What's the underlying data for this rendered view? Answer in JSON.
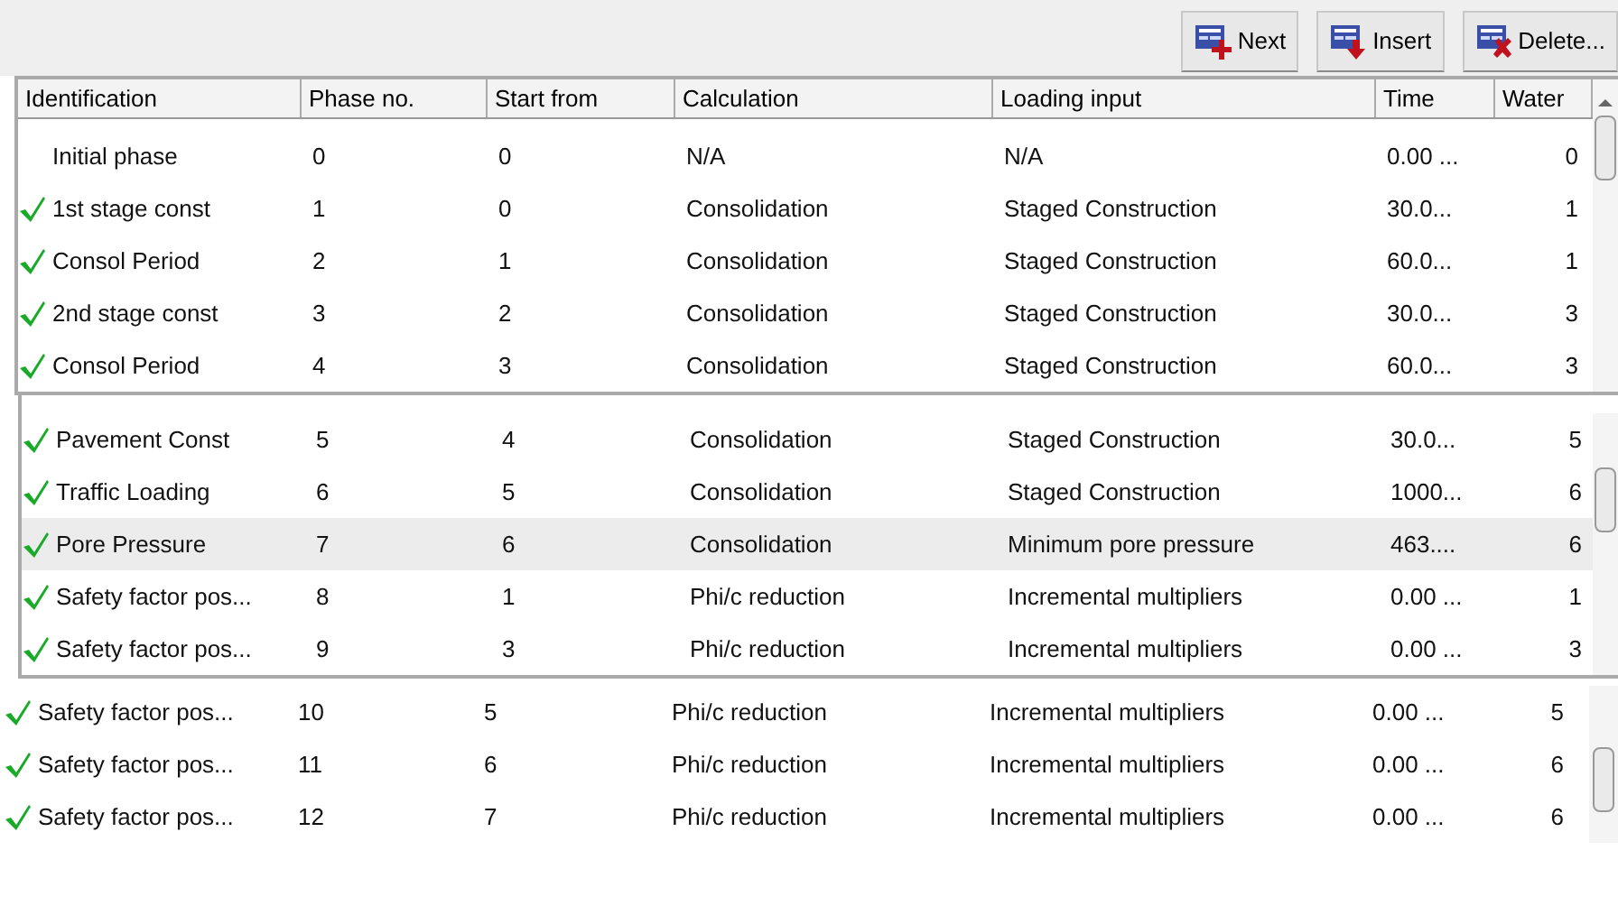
{
  "toolbar": {
    "buttons": [
      {
        "label": "Next",
        "kind": "add"
      },
      {
        "label": "Insert",
        "kind": "insert"
      },
      {
        "label": "Delete...",
        "kind": "delete"
      }
    ]
  },
  "table": {
    "columns": [
      "Identification",
      "Phase no.",
      "Start from",
      "Calculation",
      "Loading input",
      "Time",
      "Water"
    ],
    "panels": [
      {
        "rows": [
          {
            "cells": [
              "Initial phase",
              "0",
              "0",
              "N/A",
              "N/A",
              "0.00 ...",
              "0"
            ],
            "checked": false,
            "selected": false
          },
          {
            "cells": [
              "1st stage const",
              "1",
              "0",
              "Consolidation",
              "Staged Construction",
              "30.0...",
              "1"
            ],
            "checked": true,
            "selected": false
          },
          {
            "cells": [
              "Consol Period",
              "2",
              "1",
              "Consolidation",
              "Staged Construction",
              "60.0...",
              "1"
            ],
            "checked": true,
            "selected": false
          },
          {
            "cells": [
              "2nd stage const",
              "3",
              "2",
              "Consolidation",
              "Staged Construction",
              "30.0...",
              "3"
            ],
            "checked": true,
            "selected": false
          },
          {
            "cells": [
              "Consol Period",
              "4",
              "3",
              "Consolidation",
              "Staged Construction",
              "60.0...",
              "3"
            ],
            "checked": true,
            "selected": false
          }
        ]
      },
      {
        "rows": [
          {
            "cells": [
              "Pavement Const",
              "5",
              "4",
              "Consolidation",
              "Staged Construction",
              "30.0...",
              "5"
            ],
            "checked": true,
            "selected": false
          },
          {
            "cells": [
              "Traffic Loading",
              "6",
              "5",
              "Consolidation",
              "Staged Construction",
              "1000...",
              "6"
            ],
            "checked": true,
            "selected": false
          },
          {
            "cells": [
              "Pore Pressure",
              "7",
              "6",
              "Consolidation",
              "Minimum pore pressure",
              "463....",
              "6"
            ],
            "checked": true,
            "selected": true
          },
          {
            "cells": [
              "Safety factor pos...",
              "8",
              "1",
              "Phi/c reduction",
              "Incremental multipliers",
              "0.00 ...",
              "1"
            ],
            "checked": true,
            "selected": false
          },
          {
            "cells": [
              "Safety factor pos...",
              "9",
              "3",
              "Phi/c reduction",
              "Incremental multipliers",
              "0.00 ...",
              "3"
            ],
            "checked": true,
            "selected": false
          }
        ]
      },
      {
        "rows": [
          {
            "cells": [
              "Safety factor pos...",
              "10",
              "5",
              "Phi/c reduction",
              "Incremental multipliers",
              "0.00 ...",
              "5"
            ],
            "checked": true,
            "selected": false
          },
          {
            "cells": [
              "Safety factor pos...",
              "11",
              "6",
              "Phi/c reduction",
              "Incremental multipliers",
              "0.00 ...",
              "6"
            ],
            "checked": true,
            "selected": false
          },
          {
            "cells": [
              "Safety factor pos...",
              "12",
              "7",
              "Phi/c reduction",
              "Incremental multipliers",
              "0.00 ...",
              "6"
            ],
            "checked": true,
            "selected": false
          }
        ]
      }
    ]
  }
}
